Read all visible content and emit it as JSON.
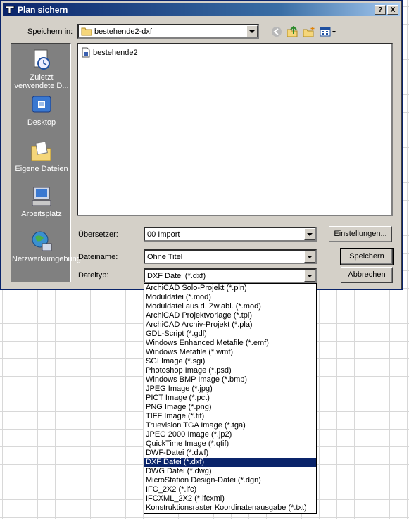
{
  "dialog": {
    "title": "Plan sichern",
    "help_btn": "?",
    "close_btn": "X"
  },
  "save_in": {
    "label": "Speichern in:",
    "value": "bestehende2-dxf"
  },
  "places": [
    {
      "label": "Zuletzt verwendete D...",
      "icon": "recent-documents-icon"
    },
    {
      "label": "Desktop",
      "icon": "desktop-icon"
    },
    {
      "label": "Eigene Dateien",
      "icon": "my-documents-icon"
    },
    {
      "label": "Arbeitsplatz",
      "icon": "my-computer-icon"
    },
    {
      "label": "Netzwerkumgebung",
      "icon": "network-icon"
    }
  ],
  "files": [
    {
      "name": "bestehende2",
      "icon": "document-icon"
    }
  ],
  "translator": {
    "label": "Übersetzer:",
    "value": "00 Import"
  },
  "filename": {
    "label": "Dateiname:",
    "value": "Ohne Titel"
  },
  "filetype": {
    "label": "Dateityp:",
    "value": "DXF Datei (*.dxf)"
  },
  "buttons": {
    "settings": "Einstellungen...",
    "save": "Speichern",
    "cancel": "Abbrechen"
  },
  "filetype_options": [
    "ArchiCAD Solo-Projekt (*.pln)",
    "Moduldatei (*.mod)",
    "Moduldatei aus d. Zw.abl. (*.mod)",
    "ArchiCAD Projektvorlage (*.tpl)",
    "ArchiCAD Archiv-Projekt (*.pla)",
    "GDL-Script (*.gdl)",
    "Windows Enhanced Metafile (*.emf)",
    "Windows Metafile (*.wmf)",
    "SGI Image (*.sgi)",
    "Photoshop Image (*.psd)",
    "Windows BMP Image (*.bmp)",
    "JPEG Image (*.jpg)",
    "PICT Image (*.pct)",
    "PNG Image (*.png)",
    "TIFF Image (*.tif)",
    "Truevision TGA Image (*.tga)",
    "JPEG 2000 Image (*.jp2)",
    "QuickTime Image (*.qtif)",
    "DWF-Datei (*.dwf)",
    "DXF Datei (*.dxf)",
    "DWG Datei (*.dwg)",
    "MicroStation Design-Datei (*.dgn)",
    "IFC_2X2 (*.ifc)",
    "IFCXML_2X2 (*.ifcxml)",
    "Konstruktionsraster Koordinatenausgabe (*.txt)"
  ],
  "selected_option": "DXF Datei (*.dxf)",
  "colors": {
    "titlebar": "#0a246a",
    "dialog_bg": "#d4d0c8",
    "selection": "#0a246a"
  }
}
